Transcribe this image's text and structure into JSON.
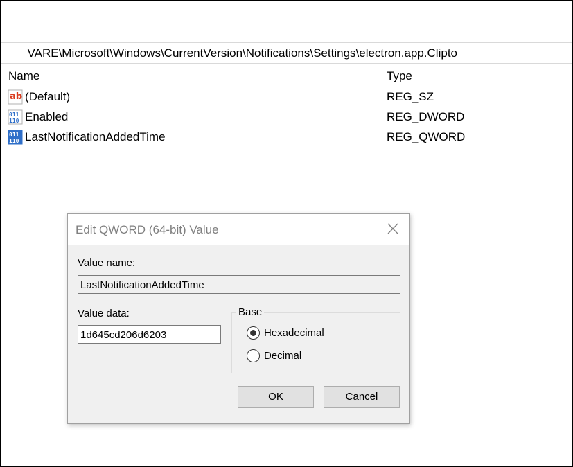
{
  "address": {
    "path": "VARE\\Microsoft\\Windows\\CurrentVersion\\Notifications\\Settings\\electron.app.Clipto"
  },
  "list": {
    "columns": {
      "name": "Name",
      "type": "Type"
    },
    "rows": [
      {
        "name": "(Default)",
        "type": "REG_SZ",
        "icon": "string-value-icon"
      },
      {
        "name": "Enabled",
        "type": "REG_DWORD",
        "icon": "binary-value-icon"
      },
      {
        "name": "LastNotificationAddedTime",
        "type": "REG_QWORD",
        "icon": "binary-value-icon"
      }
    ]
  },
  "dialog": {
    "title": "Edit QWORD (64-bit) Value",
    "value_name_label": "Value name:",
    "value_name": "LastNotificationAddedTime",
    "value_data_label": "Value data:",
    "value_data": "1d645cd206d6203",
    "base_label": "Base",
    "base_options": [
      {
        "label": "Hexadecimal",
        "selected": true
      },
      {
        "label": "Decimal",
        "selected": false
      }
    ],
    "ok_label": "OK",
    "cancel_label": "Cancel"
  },
  "colors": {
    "string_icon": "#d93a1c",
    "binary_icon": "#2f6fc9"
  }
}
